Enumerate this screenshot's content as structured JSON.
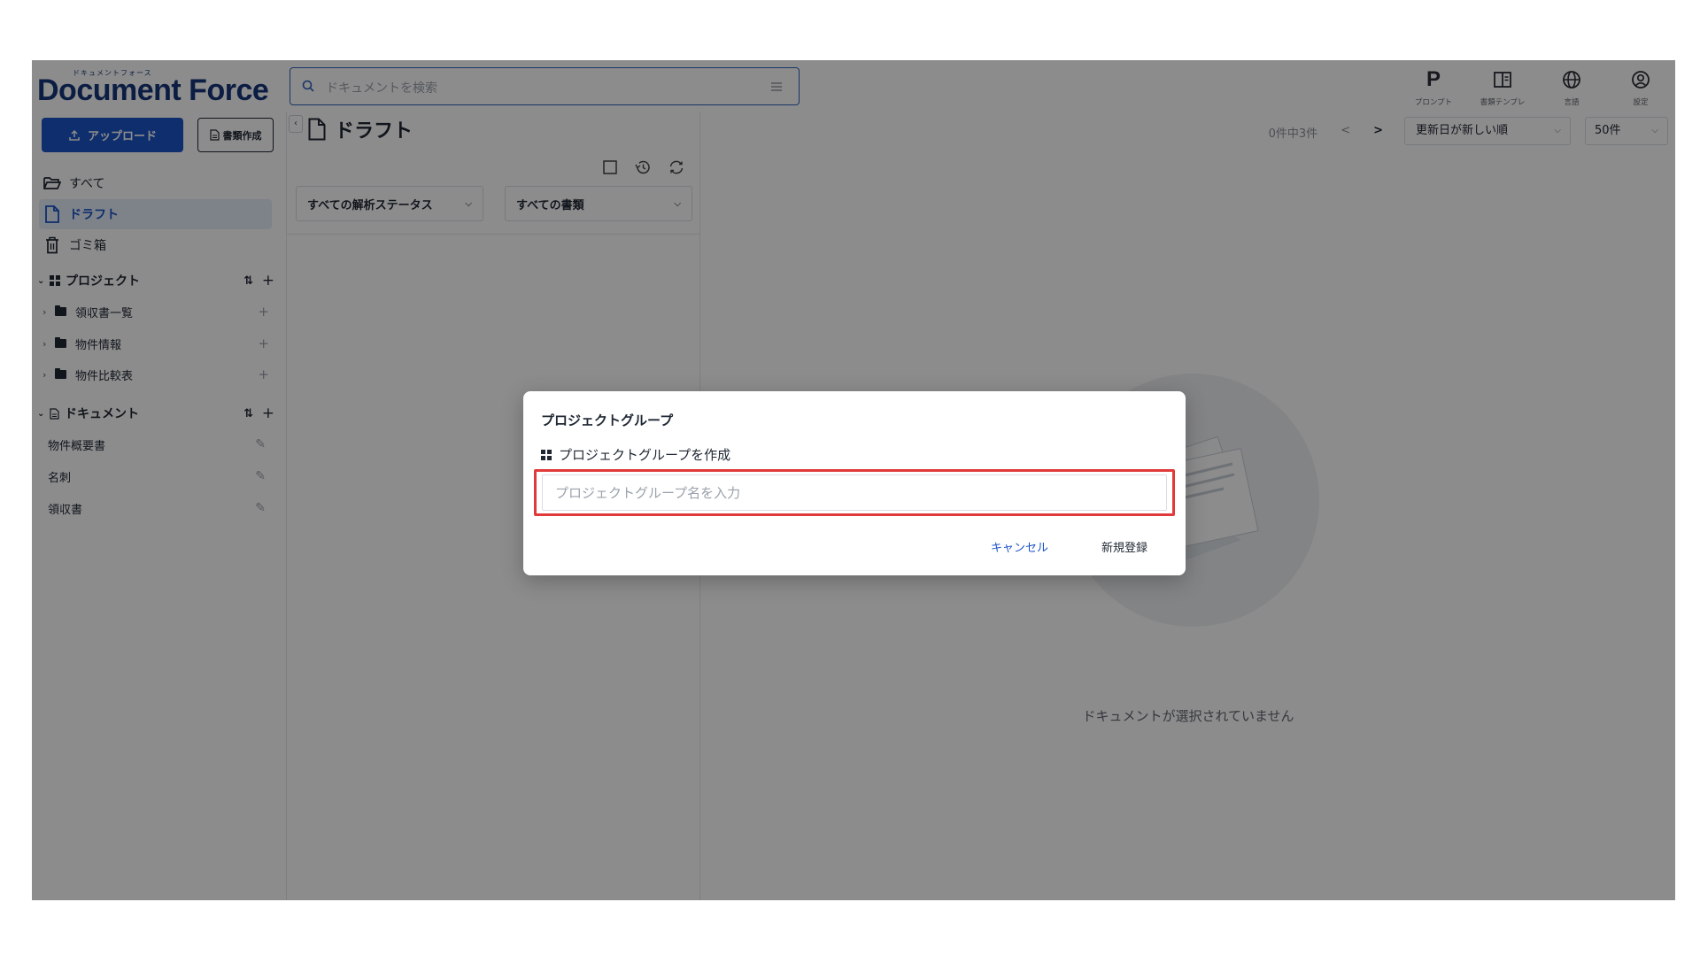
{
  "logo": {
    "kana": "ドキュメントフォース",
    "name": "Document Force"
  },
  "search": {
    "placeholder": "ドキュメントを検索"
  },
  "top_icons": [
    {
      "label": "プロンプト",
      "icon": "p-letter-icon"
    },
    {
      "label": "書類テンプレ",
      "icon": "template-icon"
    },
    {
      "label": "言語",
      "icon": "globe-icon"
    },
    {
      "label": "設定",
      "icon": "user-circle-icon"
    }
  ],
  "sidebar": {
    "upload_label": "アップロード",
    "create_label": "書類作成",
    "nav": [
      {
        "label": "すべて",
        "icon": "folder-open-icon"
      },
      {
        "label": "ドラフト",
        "icon": "file-icon",
        "active": true
      },
      {
        "label": "ゴミ箱",
        "icon": "trash-icon"
      }
    ],
    "projects": {
      "title": "プロジェクト",
      "items": [
        "領収書一覧",
        "物件情報",
        "物件比較表"
      ]
    },
    "documents": {
      "title": "ドキュメント",
      "items": [
        "物件概要書",
        "名刺",
        "領収書"
      ]
    }
  },
  "main": {
    "title": "ドラフト",
    "filters": {
      "status": "すべての解析ステータス",
      "type": "すべての書類"
    }
  },
  "right": {
    "pager_text": "0件中3件",
    "prev": "<",
    "next": ">",
    "sort": "更新日が新しい順",
    "per_page": "50件",
    "empty_text": "ドキュメントが選択されていません"
  },
  "modal": {
    "title": "プロジェクトグループ",
    "subtitle": "プロジェクトグループを作成",
    "input_placeholder": "プロジェクトグループ名を入力",
    "input_value": "",
    "cancel_label": "キャンセル",
    "submit_label": "新規登録",
    "highlight_color": "#e03a3a"
  },
  "colors": {
    "accent": "#1d54c7",
    "brand": "#16357a",
    "overlay": "rgba(0,0,0,0.45)"
  }
}
